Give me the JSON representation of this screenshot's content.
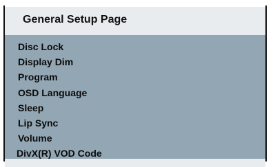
{
  "header": {
    "title": "General Setup Page"
  },
  "menu": {
    "items": [
      {
        "label": "Disc Lock"
      },
      {
        "label": "Display Dim"
      },
      {
        "label": "Program"
      },
      {
        "label": "OSD Language"
      },
      {
        "label": "Sleep"
      },
      {
        "label": "Lip Sync"
      },
      {
        "label": "Volume"
      },
      {
        "label": "DivX(R) VOD Code"
      }
    ]
  },
  "colors": {
    "header_bg": "#e8ecee",
    "list_bg": "#92a6b3",
    "border": "#111111",
    "text": "#0b0b0b"
  }
}
